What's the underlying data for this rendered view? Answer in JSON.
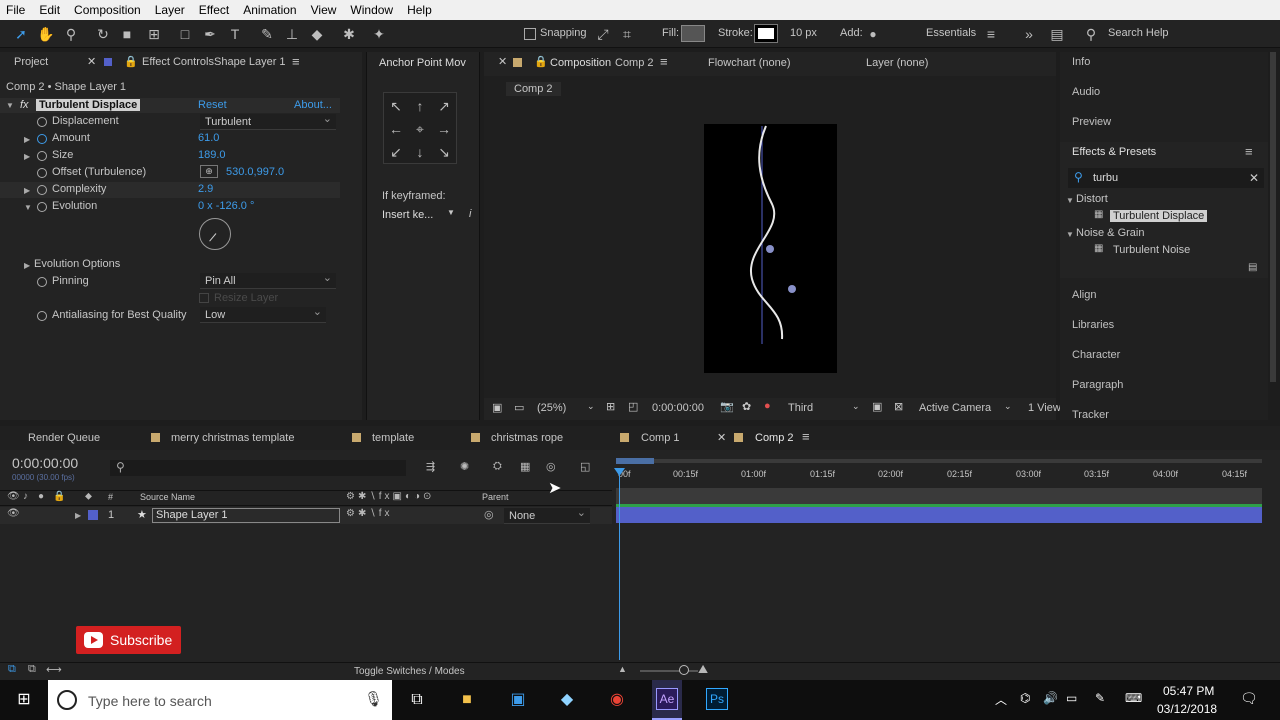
{
  "menu": [
    "File",
    "Edit",
    "Composition",
    "Layer",
    "Effect",
    "Animation",
    "View",
    "Window",
    "Help"
  ],
  "toolbar": {
    "snapping": "Snapping",
    "fill": "Fill:",
    "stroke": "Stroke:",
    "stroke_width": "10 px",
    "add": "Add:",
    "workspace": "Essentials",
    "search_placeholder": "Search Help"
  },
  "left_tabs": {
    "project": "Project",
    "effect_controls": "Effect Controls",
    "effect_controls_layer": "Shape Layer 1",
    "anchor": "Anchor Point Mov"
  },
  "effect_controls": {
    "breadcrumb": "Comp 2 • Shape Layer 1",
    "effect_name": "Turbulent Displace",
    "reset": "Reset",
    "about": "About...",
    "props": [
      {
        "name": "Displacement",
        "value": "Turbulent"
      },
      {
        "name": "Amount",
        "value": "61.0"
      },
      {
        "name": "Size",
        "value": "189.0"
      },
      {
        "name": "Offset (Turbulence)",
        "value": "530.0,997.0"
      },
      {
        "name": "Complexity",
        "value": "2.9"
      },
      {
        "name": "Evolution",
        "value": "0 x -126.0 °"
      },
      {
        "name": "Evolution Options",
        "value": ""
      },
      {
        "name": "Pinning",
        "value": "Pin All"
      },
      {
        "name": "Resize Layer",
        "value": ""
      },
      {
        "name": "Antialiasing for Best Quality",
        "value": "Low"
      }
    ]
  },
  "anchor_panel": {
    "if_keyframed": "If keyframed:",
    "insert": "Insert ke..."
  },
  "comp_panel": {
    "tab": "Composition",
    "tab_name": "Comp 2",
    "flowchart": "Flowchart (none)",
    "layer": "Layer (none)",
    "breadcrumb": "Comp 2",
    "zoom": "(25%)",
    "time": "0:00:00:00",
    "resolution": "Third",
    "camera": "Active Camera",
    "views": "1 View"
  },
  "right_panel": {
    "items_top": [
      "Info",
      "Audio",
      "Preview"
    ],
    "effects_presets": "Effects & Presets",
    "search_value": "turbu",
    "categories": [
      {
        "name": "Distort",
        "effects": [
          "Turbulent Displace"
        ]
      },
      {
        "name": "Noise & Grain",
        "effects": [
          "Turbulent Noise"
        ]
      }
    ],
    "items_bottom": [
      "Align",
      "Libraries",
      "Character",
      "Paragraph",
      "Tracker"
    ]
  },
  "timeline": {
    "tabs": [
      "Render Queue",
      "merry christmas template",
      "template",
      "christmas rope",
      "Comp 1",
      "Comp 2"
    ],
    "timecode": "0:00:00:00",
    "timecode_sub": "00000 (30.00 fps)",
    "col_source": "Source Name",
    "col_parent": "Parent",
    "col_num": "#",
    "layer": {
      "num": "1",
      "name": "Shape Layer 1",
      "parent": "None"
    },
    "ruler": [
      "00f",
      "00:15f",
      "01:00f",
      "01:15f",
      "02:00f",
      "02:15f",
      "03:00f",
      "03:15f",
      "04:00f",
      "04:15f"
    ],
    "toggle": "Toggle Switches / Modes",
    "subscribe": "Subscribe"
  },
  "taskbar": {
    "search": "Type here to search",
    "time": "05:47 PM",
    "date": "03/12/2018"
  },
  "colors": {
    "accent": "#3d9be9",
    "layer_bar": "#5360c9",
    "label_swatch": "#c8a96e"
  }
}
